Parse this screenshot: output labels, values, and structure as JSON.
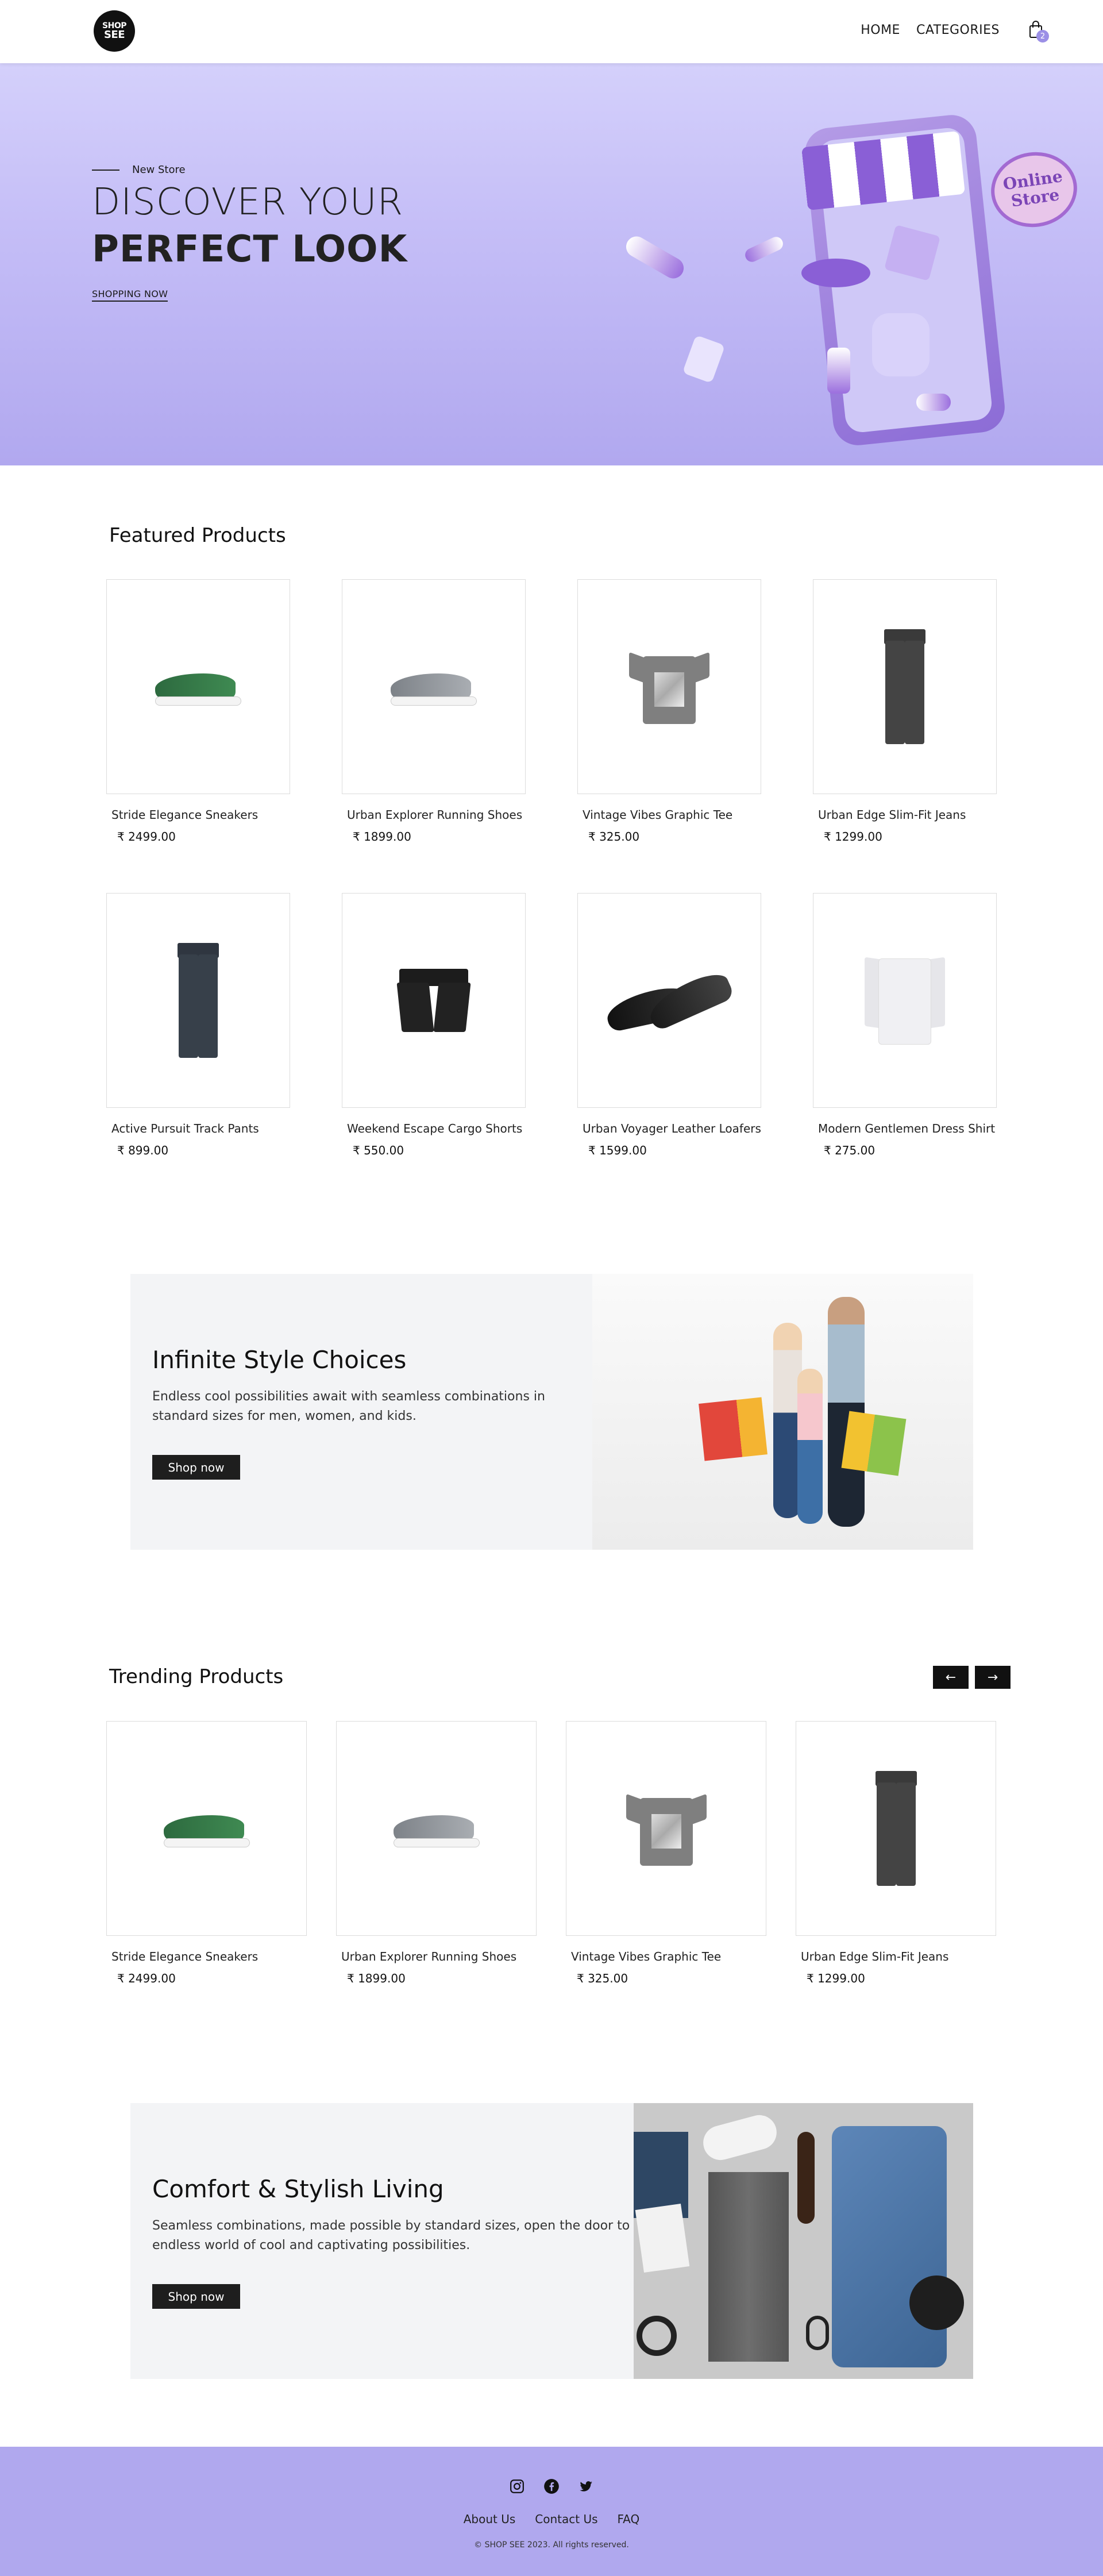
{
  "brand": {
    "logo_line1": "SHOP",
    "logo_line2": "SEE"
  },
  "nav": {
    "home": "HOME",
    "categories": "CATEGORIES",
    "cart_count": "2"
  },
  "hero": {
    "tag": "New Store",
    "title_line1": "DISCOVER YOUR",
    "title_line2": "PERFECT LOOK",
    "cta": "SHOPPING NOW",
    "badge_line1": "Online",
    "badge_line2": "Store"
  },
  "featured": {
    "title": "Featured Products",
    "products": [
      {
        "name": "Stride Elegance Sneakers",
        "price": "₹ 2499.00"
      },
      {
        "name": "Urban Explorer Running Shoes",
        "price": "₹ 1899.00"
      },
      {
        "name": "Vintage Vibes Graphic Tee",
        "price": "₹ 325.00"
      },
      {
        "name": "Urban Edge Slim-Fit Jeans",
        "price": "₹ 1299.00"
      },
      {
        "name": "Active Pursuit Track Pants",
        "price": "₹ 899.00"
      },
      {
        "name": "Weekend Escape Cargo Shorts",
        "price": "₹ 550.00"
      },
      {
        "name": "Urban Voyager Leather Loafers",
        "price": "₹ 1599.00"
      },
      {
        "name": "Modern Gentlemen Dress Shirt",
        "price": "₹ 275.00"
      }
    ]
  },
  "promo1": {
    "title": "Infinite Style Choices",
    "text_line1": "Endless cool possibilities await with seamless combinations in",
    "text_line2": "standard sizes for men, women, and kids.",
    "button": "Shop now"
  },
  "trending": {
    "title": "Trending Products",
    "prev": "←",
    "next": "→",
    "products": [
      {
        "name": "Stride Elegance Sneakers",
        "price": "₹ 2499.00"
      },
      {
        "name": "Urban Explorer Running Shoes",
        "price": "₹ 1899.00"
      },
      {
        "name": "Vintage Vibes Graphic Tee",
        "price": "₹ 325.00"
      },
      {
        "name": "Urban Edge Slim-Fit Jeans",
        "price": "₹ 1299.00"
      }
    ]
  },
  "promo2": {
    "title": "Comfort & Stylish Living",
    "text_line1": "Seamless combinations, made possible by standard sizes, open the door to an",
    "text_line2": "endless world of cool and captivating possibilities.",
    "button": "Shop now"
  },
  "footer": {
    "links": [
      "About Us",
      "Contact Us",
      "FAQ"
    ],
    "copyright": "© SHOP SEE 2023. All rights reserved."
  },
  "colors": {
    "accent": "#b0a8ee",
    "hero_top": "#d4d0fb",
    "dark": "#1e1e1e"
  }
}
